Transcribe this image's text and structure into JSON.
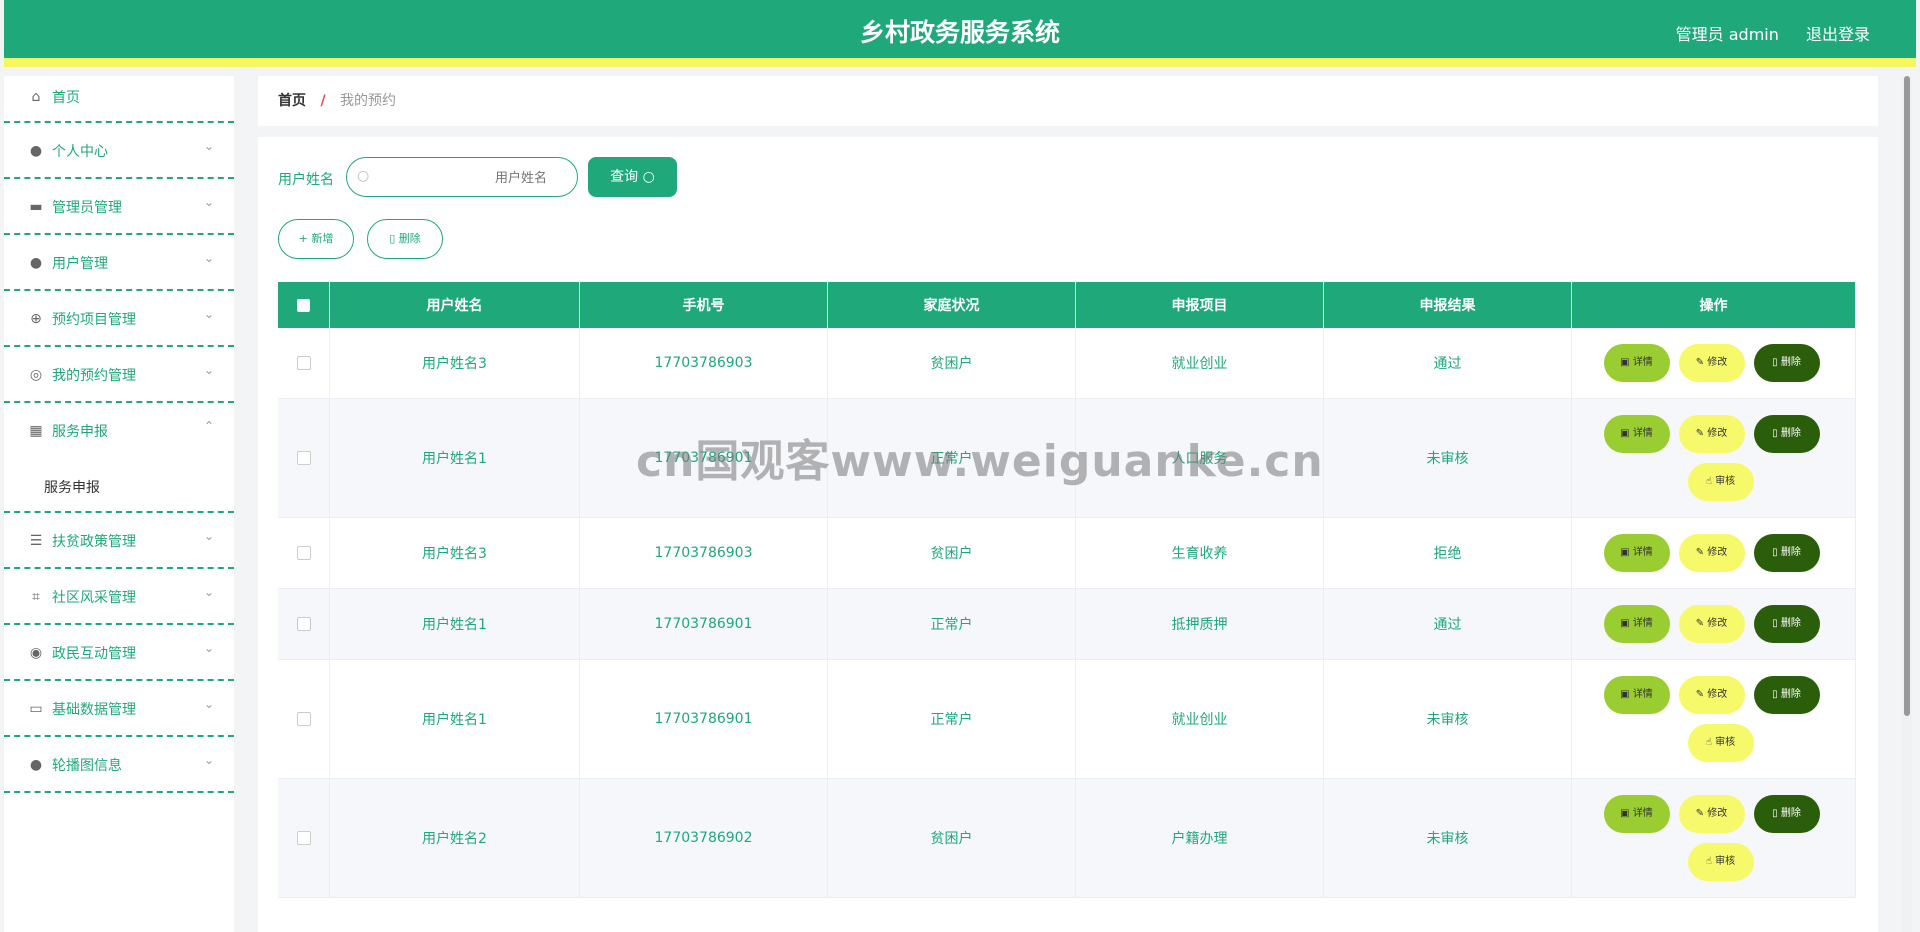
{
  "header": {
    "title": "乡村政务服务系统",
    "user_label": "管理员 admin",
    "logout_label": "退出登录"
  },
  "sidebar": {
    "items": [
      {
        "label": "首页",
        "icon": "home-icon"
      },
      {
        "label": "个人中心",
        "icon": "user-icon"
      },
      {
        "label": "管理员管理",
        "icon": "briefcase-icon"
      },
      {
        "label": "用户管理",
        "icon": "user-icon"
      },
      {
        "label": "预约项目管理",
        "icon": "target-icon"
      },
      {
        "label": "我的预约管理",
        "icon": "compass-icon"
      },
      {
        "label": "服务申报",
        "icon": "grid-icon",
        "expanded": true,
        "children": [
          "服务申报"
        ]
      },
      {
        "label": "扶贫政策管理",
        "icon": "list-icon"
      },
      {
        "label": "社区风采管理",
        "icon": "crop-icon"
      },
      {
        "label": "政民互动管理",
        "icon": "lifebuoy-icon"
      },
      {
        "label": "基础数据管理",
        "icon": "card-icon"
      },
      {
        "label": "轮播图信息",
        "icon": "balloon-icon"
      }
    ]
  },
  "breadcrumb": {
    "home": "首页",
    "current": "我的预约"
  },
  "search": {
    "label": "用户姓名",
    "placeholder": "用户姓名",
    "query_label": "查询"
  },
  "actions": {
    "add_label": "新增",
    "delete_label": "删除"
  },
  "table": {
    "headers": [
      "用户姓名",
      "手机号",
      "家庭状况",
      "申报项目",
      "申报结果",
      "操作"
    ],
    "op_labels": {
      "detail": "详情",
      "edit": "修改",
      "delete": "删除",
      "audit": "审核"
    },
    "rows": [
      {
        "name": "用户姓名3",
        "phone": "17703786903",
        "family": "贫困户",
        "project": "就业创业",
        "result": "通过"
      },
      {
        "name": "用户姓名1",
        "phone": "17703786901",
        "family": "正常户",
        "project": "人口服务",
        "result": "未审核"
      },
      {
        "name": "用户姓名3",
        "phone": "17703786903",
        "family": "贫困户",
        "project": "生育收养",
        "result": "拒绝"
      },
      {
        "name": "用户姓名1",
        "phone": "17703786901",
        "family": "正常户",
        "project": "抵押质押",
        "result": "通过"
      },
      {
        "name": "用户姓名1",
        "phone": "17703786901",
        "family": "正常户",
        "project": "就业创业",
        "result": "未审核"
      },
      {
        "name": "用户姓名2",
        "phone": "17703786902",
        "family": "贫困户",
        "project": "户籍办理",
        "result": "未审核"
      }
    ]
  },
  "watermark": "cn国观客www.weiguanke.cn",
  "colors": {
    "primary": "#1fa97b",
    "accent_yellow": "#f4f75e",
    "detail": "#9acd32",
    "delete": "#2b5e0b"
  }
}
